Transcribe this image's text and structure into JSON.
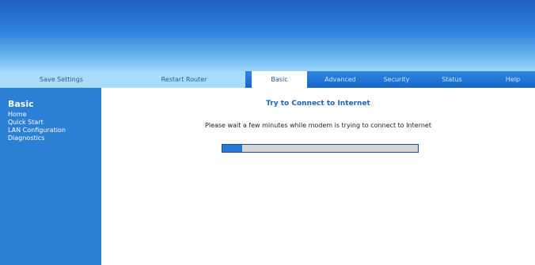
{
  "nav": {
    "save_settings": "Save Settings",
    "restart_router": "Restart Router",
    "basic": "Basic",
    "advanced": "Advanced",
    "security": "Security",
    "status": "Status",
    "help": "Help"
  },
  "sidebar": {
    "title": "Basic",
    "items": [
      {
        "label": "Home"
      },
      {
        "label": "Quick Start"
      },
      {
        "label": "LAN Configuration"
      },
      {
        "label": "Diagnostics"
      }
    ]
  },
  "main": {
    "title": "Try to Connect to Internet",
    "message": "Please wait a few minutes while modem is trying to connect to Internet",
    "progress_fraction": 0.1
  },
  "colors": {
    "banner_top": "#1f5fc0",
    "nav_light": "#a8dcf8",
    "nav_dark": "#1667c8",
    "sidebar": "#2b7fd4",
    "progress_fill": "#2a78d6",
    "progress_track": "#d6d6d6"
  }
}
